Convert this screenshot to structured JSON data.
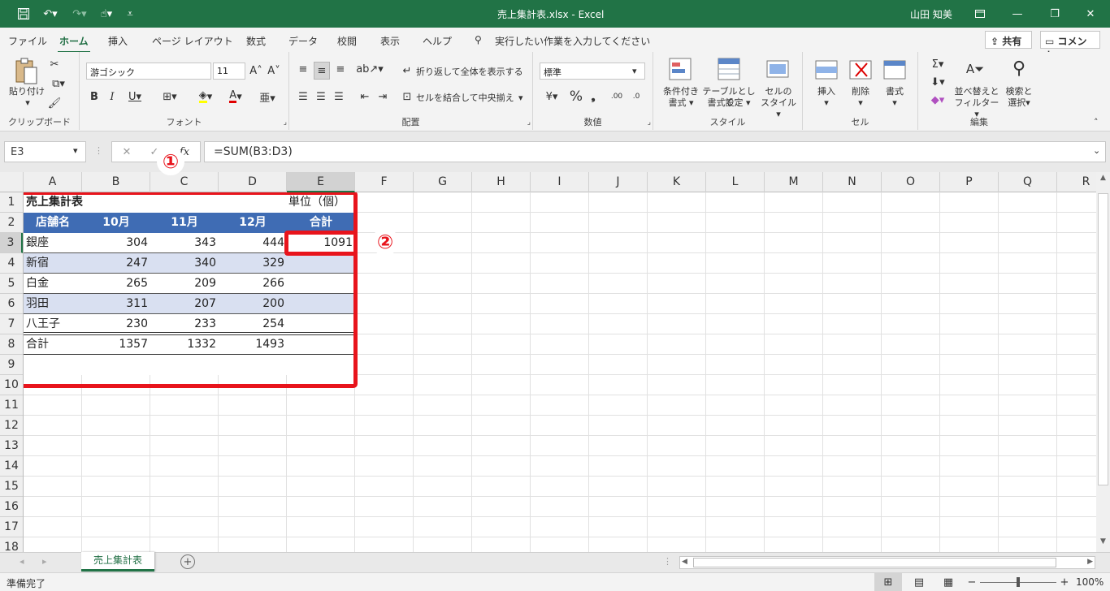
{
  "window": {
    "title": "売上集計表.xlsx  -  Excel",
    "user": "山田 知美",
    "accent": "#217346"
  },
  "tabs": [
    "ファイル",
    "ホーム",
    "挿入",
    "ページ レイアウト",
    "数式",
    "データ",
    "校閲",
    "表示",
    "ヘルプ"
  ],
  "search_placeholder": "実行したい作業を入力してください",
  "share_label": "共有",
  "comment_label": "コメント",
  "ribbon": {
    "clipboard": {
      "label": "クリップボード",
      "paste": "貼り付け"
    },
    "font": {
      "label": "フォント",
      "family": "游ゴシック",
      "size": "11"
    },
    "alignment": {
      "label": "配置",
      "wrap": "折り返して全体を表示する",
      "merge": "セルを結合して中央揃え"
    },
    "number": {
      "label": "数値",
      "format": "標準"
    },
    "styles": {
      "label": "スタイル",
      "cond1": "条件付き",
      "cond2": "書式",
      "table1": "テーブルとして",
      "table2": "書式設定",
      "cell1": "セルの",
      "cell2": "スタイル"
    },
    "cells": {
      "label": "セル",
      "insert": "挿入",
      "delete": "削除",
      "format": "書式"
    },
    "editing": {
      "label": "編集",
      "sort1": "並べ替えと",
      "sort2": "フィルター",
      "find1": "検索と",
      "find2": "選択"
    }
  },
  "namebox": "E3",
  "formula": "=SUM(B3:D3)",
  "columns": [
    "A",
    "B",
    "C",
    "D",
    "E",
    "F",
    "G",
    "H",
    "I",
    "J",
    "K",
    "L",
    "M",
    "N",
    "O",
    "P",
    "Q",
    "R"
  ],
  "rows": [
    "1",
    "2",
    "3",
    "4",
    "5",
    "6",
    "7",
    "8",
    "9",
    "10",
    "11",
    "12",
    "13",
    "14",
    "15",
    "16",
    "17",
    "18"
  ],
  "sheet": {
    "title": "売上集計表",
    "unit": "単位（個）",
    "headers": [
      "店舗名",
      "10月",
      "11月",
      "12月",
      "合計"
    ],
    "data": [
      [
        "銀座",
        "304",
        "343",
        "444",
        "1091"
      ],
      [
        "新宿",
        "247",
        "340",
        "329",
        ""
      ],
      [
        "白金",
        "265",
        "209",
        "266",
        ""
      ],
      [
        "羽田",
        "311",
        "207",
        "200",
        ""
      ],
      [
        "八王子",
        "230",
        "233",
        "254",
        ""
      ]
    ],
    "total": [
      "合計",
      "1357",
      "1332",
      "1493",
      ""
    ]
  },
  "callouts": [
    "①",
    "②"
  ],
  "sheet_tab": "売上集計表",
  "status_text": "準備完了",
  "zoom": "100%"
}
